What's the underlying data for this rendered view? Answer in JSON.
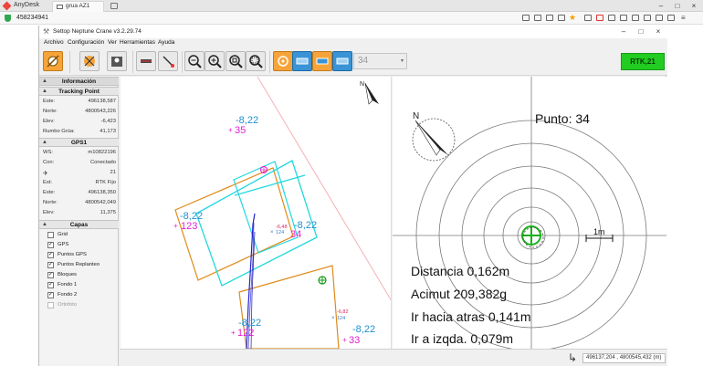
{
  "anydesk": {
    "app_name": "AnyDesk",
    "tab_label": "grua AZ1",
    "address": "458234941",
    "window_controls": {
      "minimize": "–",
      "maximize": "□",
      "close": "×"
    }
  },
  "app": {
    "title": "Settop Neptune Crane v3.2.29.74",
    "window_controls": {
      "minimize": "–",
      "maximize": "□",
      "close": "×"
    },
    "menu": [
      "Archivo",
      "Configuración",
      "Ver",
      "Herramientas",
      "Ayuda"
    ],
    "toolbar": {
      "point_number": "34",
      "status": "RTK,21",
      "status_color": "#22cc22"
    }
  },
  "panel": {
    "info_title": "Información",
    "tracking": {
      "title": "Tracking Point",
      "rows": [
        {
          "k": "Este:",
          "v": "496138,587"
        },
        {
          "k": "Norte:",
          "v": "4800543,226"
        },
        {
          "k": "Elev:",
          "v": "-6,423"
        },
        {
          "k": "Rumbo Grúa:",
          "v": "41,173"
        }
      ]
    },
    "gps": {
      "title": "GPS1",
      "rows": [
        {
          "k": "WS:",
          "v": "m10822196"
        },
        {
          "k": "Con:",
          "v": "Conectado"
        },
        {
          "k": "",
          "v": "21"
        },
        {
          "k": "Est:",
          "v": "RTK Fijo"
        },
        {
          "k": "Este:",
          "v": "496138,350"
        },
        {
          "k": "Norte:",
          "v": "4800542,049"
        },
        {
          "k": "Elev:",
          "v": "11,375"
        }
      ]
    },
    "layers": {
      "title": "Capas",
      "items": [
        {
          "label": "Grid",
          "checked": false,
          "enabled": true
        },
        {
          "label": "GPS",
          "checked": true,
          "enabled": true
        },
        {
          "label": "Puntos GPS",
          "checked": true,
          "enabled": true
        },
        {
          "label": "Puntos Replanteo",
          "checked": true,
          "enabled": true
        },
        {
          "label": "Bloques",
          "checked": true,
          "enabled": true
        },
        {
          "label": "Fondo 1",
          "checked": true,
          "enabled": true
        },
        {
          "label": "Fondo 2",
          "checked": true,
          "enabled": true
        },
        {
          "label": "Ortofoto",
          "checked": false,
          "enabled": false
        }
      ]
    }
  },
  "map": {
    "north_label": "N",
    "labels": {
      "p35_elev": "-8,22",
      "p35_id": "35",
      "p123_elev": "-8,22",
      "p123_id": "123",
      "p34_elev": "-8,22",
      "p34_id": "34",
      "p34_small_elev": "-6,48",
      "p34_small_id": "124",
      "p122_elev": "-8,22",
      "p122_id": "122",
      "p33_elev": "-8,22",
      "p33_id": "33",
      "p33_small_elev": "-6,82",
      "p33_small_id": "124"
    },
    "colors": {
      "elev": "#1e90d0",
      "id": "#e020d0",
      "cyan": "#22d8e0",
      "orange": "#e08a1a",
      "track": "#2222cc"
    }
  },
  "target": {
    "north_label": "N",
    "punto": "Punto: 34",
    "scale_label": "1m",
    "lines": [
      "Distancia 0,162m",
      "Acimut 209,382g",
      "Ir hacia atras 0,141m",
      "Ir a izqda. 0,079m"
    ]
  },
  "statusbar": {
    "coords": "496137,204 , 4800545,432 (m)"
  }
}
